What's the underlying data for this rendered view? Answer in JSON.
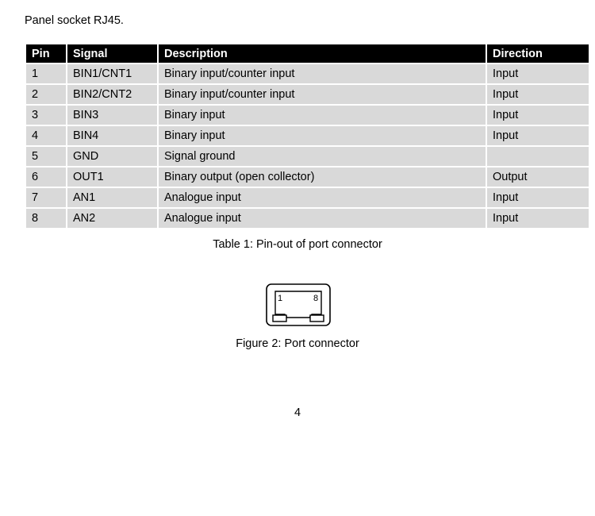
{
  "document": {
    "intro_text": "Panel socket RJ45.",
    "page_number": "4"
  },
  "table": {
    "caption": "Table 1: Pin-out of port connector",
    "headers": {
      "pin": "Pin",
      "signal": "Signal",
      "description": "Description",
      "direction": "Direction"
    },
    "colors": {
      "header_background": "#000000",
      "header_text": "#ffffff",
      "row_background": "#d9d9d9",
      "row_text": "#000000",
      "page_background": "#ffffff"
    },
    "rows": [
      {
        "pin": "1",
        "signal": "BIN1/CNT1",
        "description": "Binary input/counter input",
        "direction": "Input"
      },
      {
        "pin": "2",
        "signal": "BIN2/CNT2",
        "description": "Binary input/counter input",
        "direction": "Input"
      },
      {
        "pin": "3",
        "signal": "BIN3",
        "description": "Binary input",
        "direction": "Input"
      },
      {
        "pin": "4",
        "signal": "BIN4",
        "description": "Binary input",
        "direction": "Input"
      },
      {
        "pin": "5",
        "signal": "GND",
        "description": "Signal ground",
        "direction": ""
      },
      {
        "pin": "6",
        "signal": "OUT1",
        "description": "Binary output (open collector)",
        "direction": "Output"
      },
      {
        "pin": "7",
        "signal": "AN1",
        "description": "Analogue input",
        "direction": "Input"
      },
      {
        "pin": "8",
        "signal": "AN2",
        "description": "Analogue input",
        "direction": "Input"
      }
    ]
  },
  "figure": {
    "caption": "Figure 2: Port connector",
    "pin_label_left": "1",
    "pin_label_right": "8",
    "icon_name": "rj45-socket-icon"
  }
}
